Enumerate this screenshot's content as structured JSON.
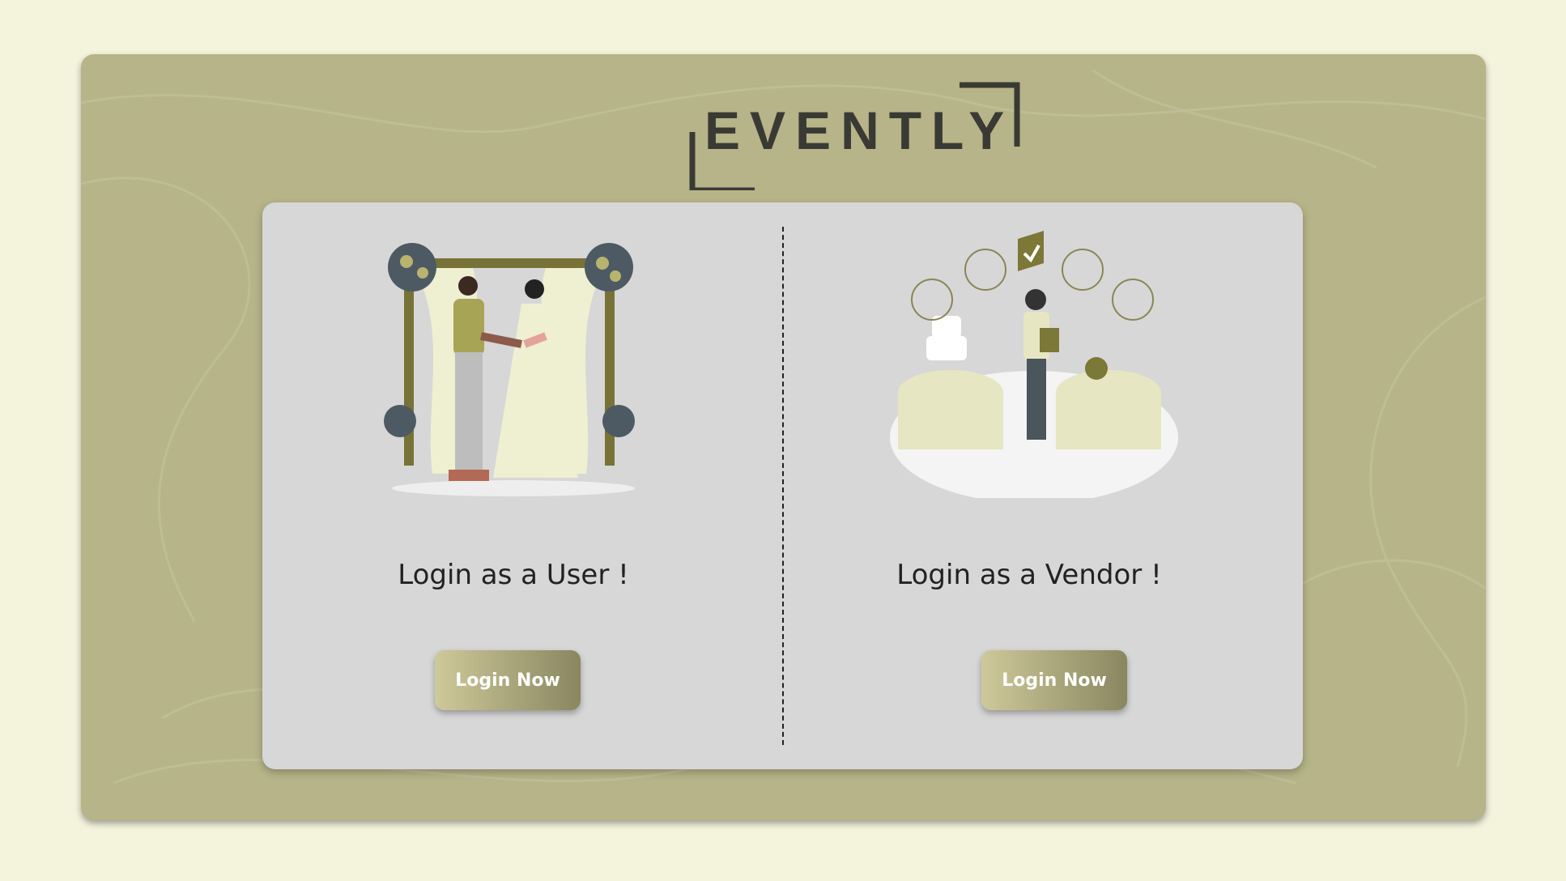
{
  "brand": {
    "name": "EVENTLY"
  },
  "user_panel": {
    "title": "Login as a User !",
    "button_label": "Login Now"
  },
  "vendor_panel": {
    "title": "Login as a Vendor !",
    "button_label": "Login Now"
  },
  "colors": {
    "page_bg": "#f4f4dd",
    "frame_bg": "#b6b488",
    "card_bg": "#d7d7d7",
    "accent": "#8a8660"
  }
}
